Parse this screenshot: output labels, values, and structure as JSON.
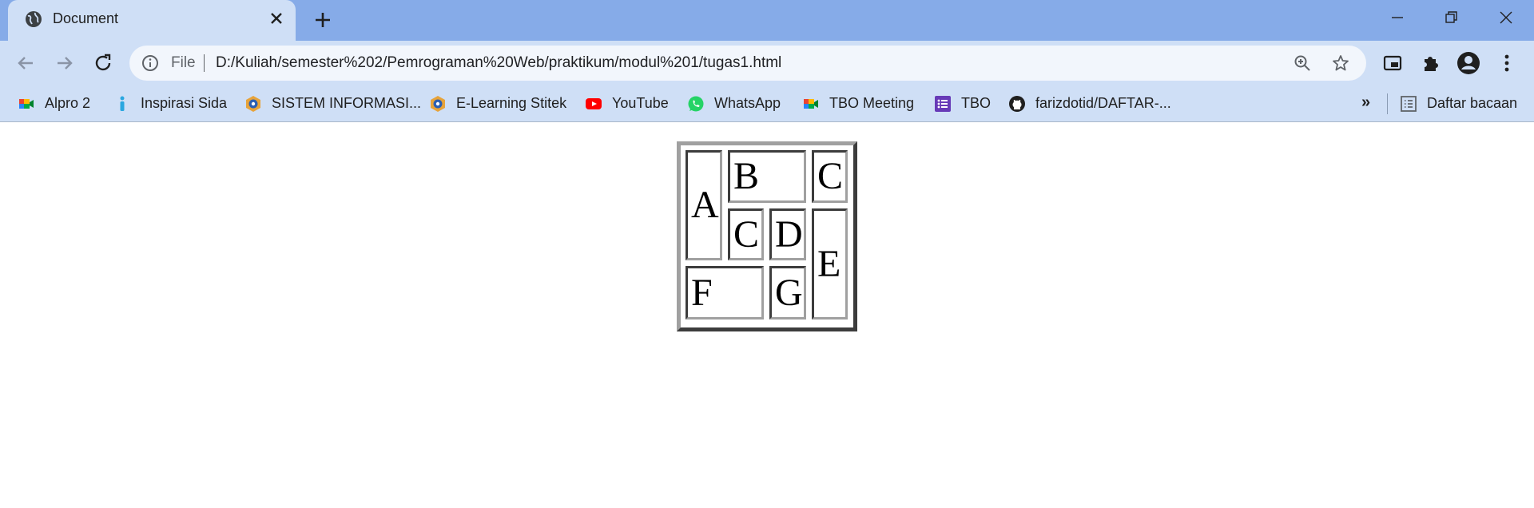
{
  "tab": {
    "title": "Document"
  },
  "toolbar": {
    "scheme_label": "File",
    "url": "D:/Kuliah/semester%202/Pemrograman%20Web/praktikum/modul%201/tugas1.html"
  },
  "bookmarks": [
    {
      "label": "Alpro 2",
      "icon": "google-meet-icon"
    },
    {
      "label": "Inspirasi Sida",
      "icon": "info-icon"
    },
    {
      "label": "SISTEM INFORMASI...",
      "icon": "campus-logo-icon"
    },
    {
      "label": "E-Learning Stitek",
      "icon": "campus-logo-icon"
    },
    {
      "label": "YouTube",
      "icon": "youtube-icon"
    },
    {
      "label": "WhatsApp",
      "icon": "whatsapp-icon"
    },
    {
      "label": "TBO Meeting",
      "icon": "google-meet-icon"
    },
    {
      "label": "TBO",
      "icon": "google-forms-icon"
    },
    {
      "label": "farizdotid/DAFTAR-...",
      "icon": "github-icon"
    }
  ],
  "bookmarks_more": "»",
  "reading_list": {
    "label": "Daftar bacaan"
  },
  "table": {
    "cells": {
      "a": "A",
      "b": "B",
      "c_top": "C",
      "c_mid": "C",
      "d": "D",
      "e": "E",
      "f": "F",
      "g": "G"
    }
  },
  "colors": {
    "frame": "#86abe8",
    "toolbar": "#cfdff6",
    "omnibox": "#f2f6fc",
    "youtube": "#ff0000",
    "whatsapp": "#25d366",
    "forms": "#673ab7"
  }
}
